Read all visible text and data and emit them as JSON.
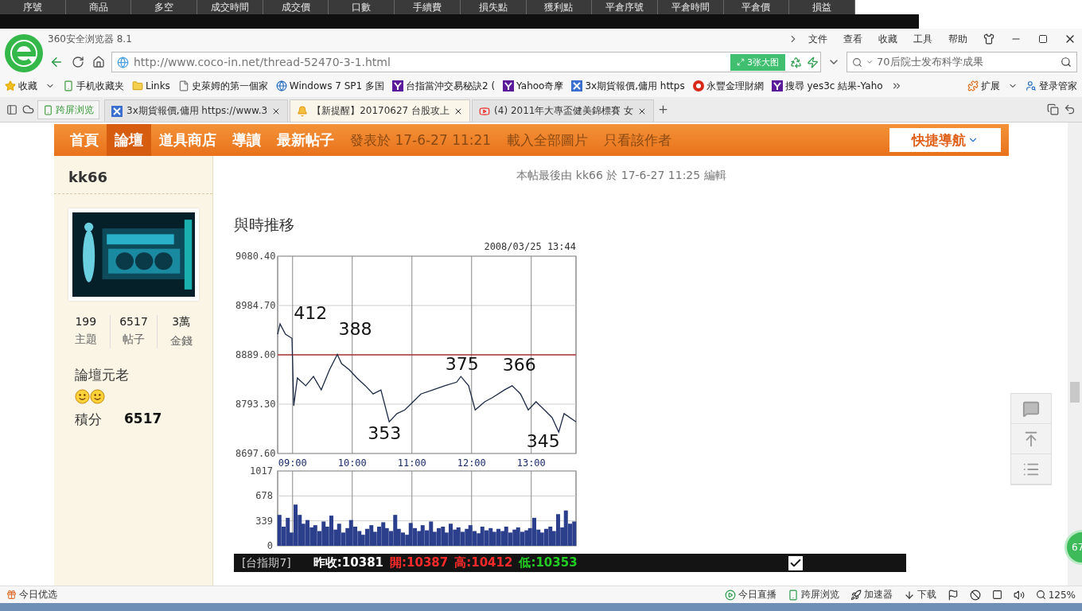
{
  "trading_strip": {
    "columns": [
      "序號",
      "商品",
      "多空",
      "成交時間",
      "成交價",
      "口數",
      "手續費",
      "損失點",
      "獲利點",
      "平倉序號",
      "平倉時間",
      "平倉價",
      "損益"
    ]
  },
  "browser": {
    "title": "360安全浏览器 8.1",
    "menu": [
      "文件",
      "查看",
      "收藏",
      "工具",
      "帮助"
    ],
    "url": "http://www.coco-in.net/thread-52470-3-1.html",
    "image_badge": "3张大图",
    "search": {
      "value": "70后院士发布科学成果"
    }
  },
  "bookmarks": [
    {
      "label": "收藏",
      "kind": "star"
    },
    {
      "label": "手机收藏夹",
      "kind": "phone"
    },
    {
      "label": "Links",
      "kind": "folder"
    },
    {
      "label": "史萊姆的第一個家",
      "kind": "page"
    },
    {
      "label": "Windows 7 SP1 多国",
      "kind": "globe"
    },
    {
      "label": "台指當沖交易秘訣2 (",
      "kind": "yahoo"
    },
    {
      "label": "Yahoo奇摩",
      "kind": "yahoo"
    },
    {
      "label": "3x期貨報價,傭用 https",
      "kind": "cross"
    },
    {
      "label": "永豐金理財網",
      "kind": "coin"
    },
    {
      "label": "搜尋 yes3c 結果-Yaho",
      "kind": "yahoo"
    }
  ],
  "bookmark_tools": [
    "扩展",
    "登录管家"
  ],
  "cross_screen": "跨屏浏览",
  "tabs": [
    {
      "label": "3x期貨報價,傭用 https://www.3",
      "kind": "cross",
      "selected": false
    },
    {
      "label": "【新提醒】20170627 台股攻上",
      "kind": "bell",
      "selected": true
    },
    {
      "label": "(4) 2011年大專盃健美錦標賽 女",
      "kind": "video",
      "selected": false
    }
  ],
  "site_nav": {
    "items": [
      {
        "label": "首頁",
        "selected": false
      },
      {
        "label": "論壇",
        "selected": true
      },
      {
        "label": "道具商店",
        "selected": false
      },
      {
        "label": "導讀",
        "selected": false
      },
      {
        "label": "最新帖子",
        "selected": false
      }
    ],
    "overlay": [
      "發表於 17-6-27 11:21",
      "載入全部圖片",
      "只看該作者"
    ],
    "quick_nav": "快捷導航"
  },
  "author": {
    "name": "kk66",
    "stats": [
      {
        "value": "199",
        "label": "主題"
      },
      {
        "value": "6517",
        "label": "帖子"
      },
      {
        "value": "3萬",
        "label": "金錢"
      }
    ],
    "rank": "論壇元老",
    "rank_icons": [
      {
        "kind": "smiley"
      },
      {
        "kind": "smiley"
      }
    ],
    "points": {
      "label": "積分",
      "value": "6517"
    }
  },
  "post": {
    "edit_note": "本帖最後由 kk66 於 17-6-27 11:25 編輯",
    "heading": "與時推移",
    "price_chart": {
      "chart_data": {
        "type": "line",
        "title": "2008/03/25 13:44",
        "xlim": [
          8.75,
          13.75
        ],
        "ylim": [
          8697.6,
          9080.4
        ],
        "xticks": [
          {
            "value": 9,
            "label": "09:00"
          },
          {
            "value": 10,
            "label": "10:00"
          },
          {
            "value": 11,
            "label": "11:00"
          },
          {
            "value": 12,
            "label": "12:00"
          },
          {
            "value": 13,
            "label": "13:00"
          }
        ],
        "yticks": [
          {
            "value": 8697.6,
            "label": "8697.60"
          },
          {
            "value": 8793.3,
            "label": "8793.30"
          },
          {
            "value": 8889,
            "label": "8889.00"
          },
          {
            "value": 8984.7,
            "label": "8984.70"
          },
          {
            "value": 9080.4,
            "label": "9080.40"
          }
        ],
        "x": [
          8.75,
          8.79,
          8.88,
          8.99,
          9.02,
          9.08,
          9.22,
          9.35,
          9.48,
          9.62,
          9.75,
          9.82,
          9.95,
          10.08,
          10.22,
          10.35,
          10.48,
          10.62,
          10.75,
          10.88,
          11.02,
          11.15,
          11.35,
          11.55,
          11.75,
          11.82,
          11.95,
          12.06,
          12.22,
          12.35,
          12.55,
          12.68,
          12.82,
          12.95,
          13.08,
          13.22,
          13.35,
          13.46,
          13.55,
          13.75
        ],
        "grid": true,
        "series": [
          {
            "color": "#1c2a44",
            "values": [
              8929,
              8949,
              8929,
              8921,
              8790,
              8844,
              8829,
              8847,
              8821,
              8860,
              8890,
              8872,
              8860,
              8844,
              8829,
              8813,
              8821,
              8759,
              8775,
              8782,
              8798,
              8813,
              8821,
              8829,
              8836,
              8847,
              8829,
              8782,
              8798,
              8806,
              8821,
              8829,
              8813,
              8782,
              8798,
              8782,
              8767,
              8739,
              8775,
              8759
            ]
          }
        ],
        "ref_lines": [
          {
            "axis": "y",
            "value": 8889
          }
        ],
        "annotations": [
          "412",
          "388",
          "353",
          "375",
          "366",
          "345"
        ]
      }
    },
    "volume_chart": {
      "chart_data": {
        "type": "bar",
        "xlim": [
          8.75,
          13.75
        ],
        "ylim": [
          0,
          1017
        ],
        "yticks": [
          {
            "value": 0,
            "label": "0"
          },
          {
            "value": 339,
            "label": "339"
          },
          {
            "value": 678,
            "label": "678"
          },
          {
            "value": 1017,
            "label": "1017"
          }
        ],
        "x": [
          8.78,
          8.85,
          8.92,
          8.98,
          9.05,
          9.12,
          9.18,
          9.25,
          9.32,
          9.38,
          9.45,
          9.52,
          9.58,
          9.65,
          9.72,
          9.78,
          9.85,
          9.92,
          9.98,
          10.05,
          10.12,
          10.18,
          10.25,
          10.32,
          10.38,
          10.45,
          10.52,
          10.58,
          10.65,
          10.72,
          10.78,
          10.85,
          10.92,
          10.98,
          11.05,
          11.12,
          11.18,
          11.25,
          11.32,
          11.38,
          11.45,
          11.52,
          11.58,
          11.65,
          11.72,
          11.78,
          11.85,
          11.92,
          11.98,
          12.05,
          12.12,
          12.18,
          12.25,
          12.32,
          12.38,
          12.45,
          12.52,
          12.58,
          12.65,
          12.72,
          12.78,
          12.85,
          12.92,
          12.98,
          13.05,
          13.12,
          13.18,
          13.25,
          13.32,
          13.38,
          13.45,
          13.52,
          13.58,
          13.65,
          13.72
        ],
        "grid": true,
        "series": [
          {
            "color": "#2b3f8c",
            "values": [
              420,
              260,
              380,
              180,
              560,
              420,
              300,
              350,
              250,
              280,
              200,
              330,
              260,
              410,
              220,
              300,
              180,
              240,
              350,
              260,
              200,
              150,
              230,
              280,
              190,
              260,
              320,
              240,
              200,
              420,
              230,
              180,
              150,
              310,
              240,
              200,
              280,
              210,
              330,
              190,
              240,
              260,
              180,
              300,
              220,
              250,
              190,
              230,
              280,
              200,
              170,
              260,
              210,
              240,
              190,
              230,
              200,
              260,
              180,
              220,
              250,
              190,
              210,
              240,
              380,
              220,
              180,
              230,
              260,
              200,
              430,
              250,
              480,
              300,
              330
            ]
          }
        ]
      }
    },
    "quote_bar": {
      "label": "[台指期7]",
      "items": [
        {
          "label": "昨收:",
          "value": "10381",
          "color": "#ffffff"
        },
        {
          "label": "閞:",
          "value": "10387",
          "color": "#ff2a2a"
        },
        {
          "label": "高:",
          "value": "10412",
          "color": "#ff2a2a"
        },
        {
          "label": "低:",
          "value": "10353",
          "color": "#22cc22"
        }
      ],
      "checkbox": {
        "checked": true
      }
    }
  },
  "side_badge": "67",
  "status_bar": {
    "left": "今日优选",
    "items": [
      {
        "label": "今日直播",
        "kind": "play"
      },
      {
        "label": "跨屏浏览",
        "kind": "phone"
      },
      {
        "label": "加速器",
        "kind": "rocket"
      },
      {
        "label": "下载",
        "kind": "download"
      }
    ],
    "zoom": "125%"
  }
}
